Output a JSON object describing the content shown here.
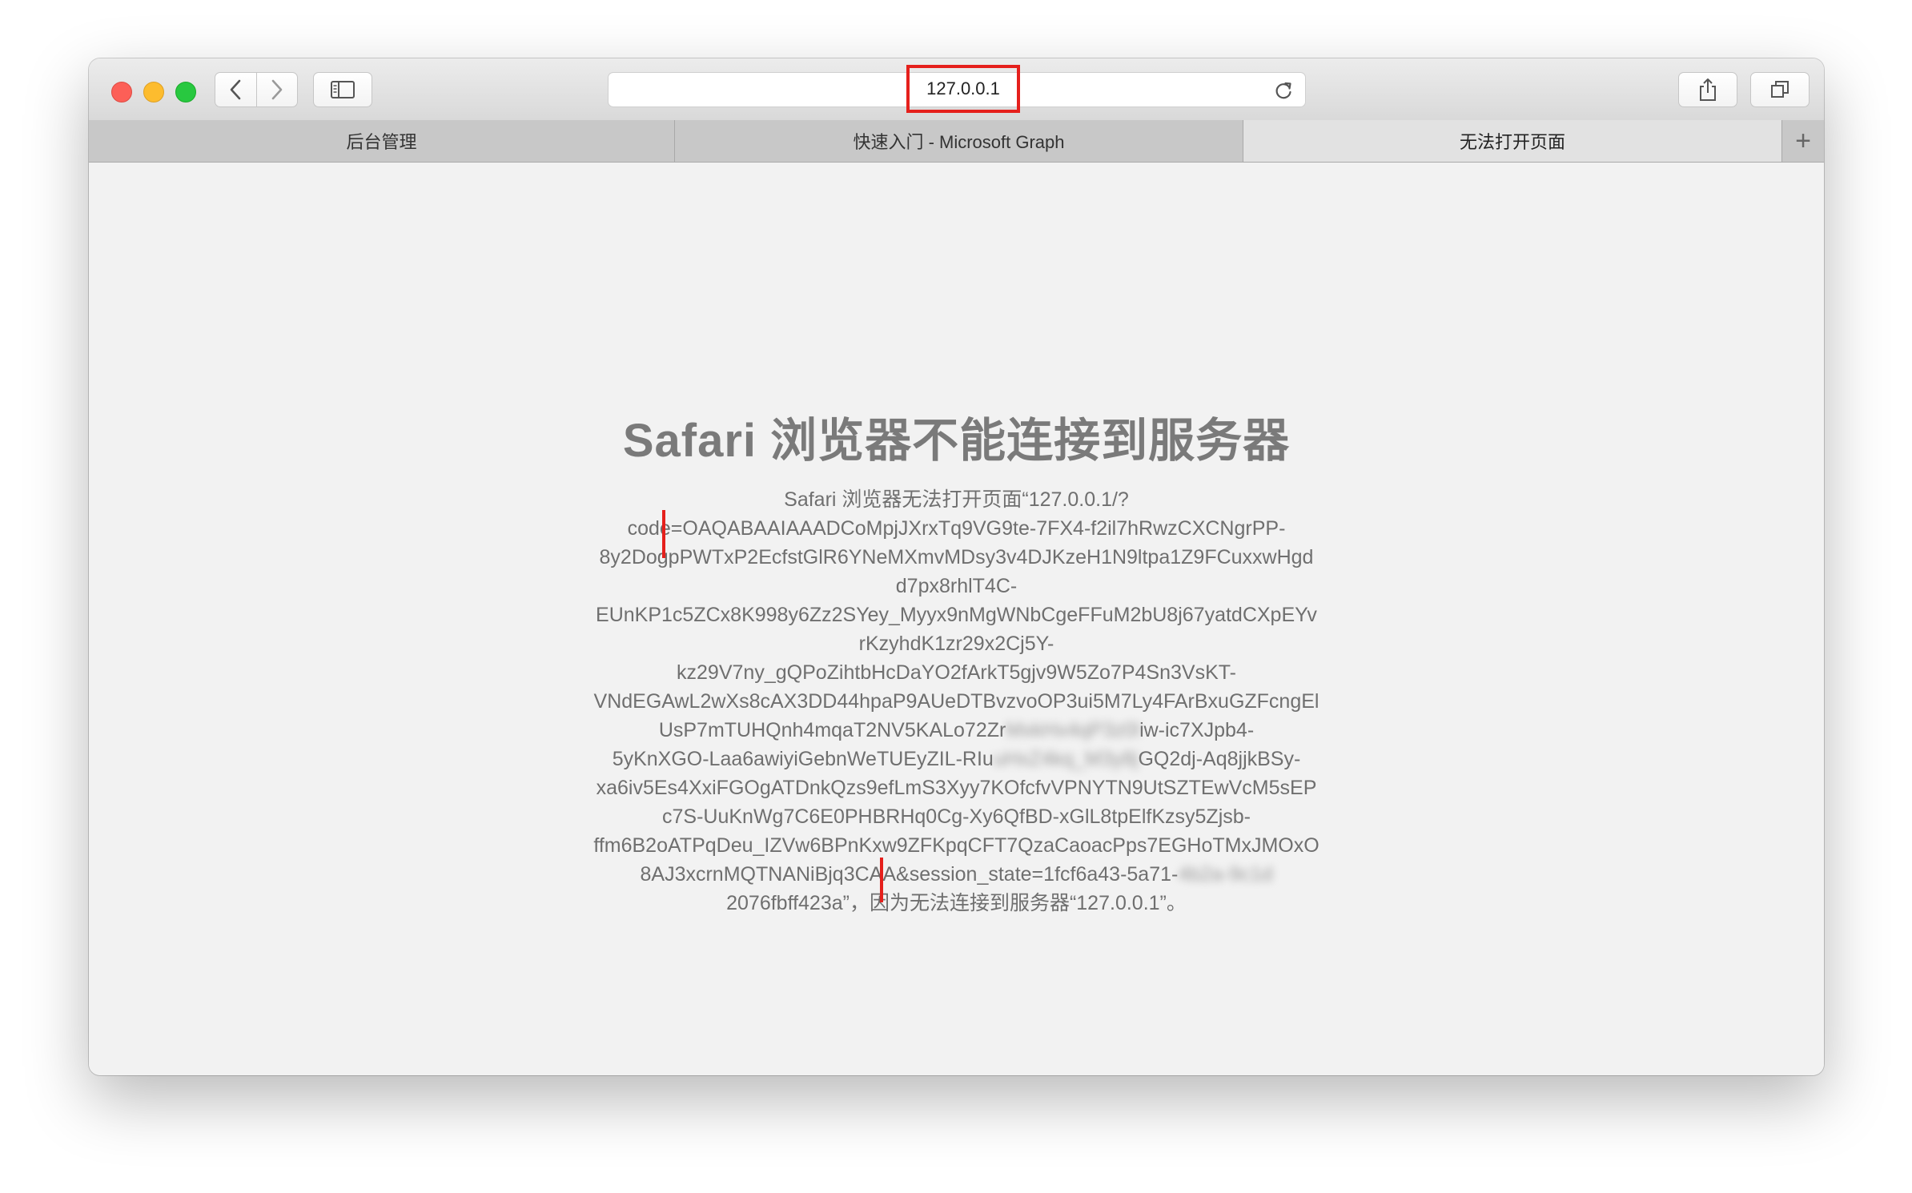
{
  "window": {
    "traffic_lights": {
      "close": "#fc5f57",
      "minimize": "#fdbc2e",
      "maximize": "#28c840"
    }
  },
  "toolbar": {
    "back_icon": "chevron-left",
    "forward_icon": "chevron-right",
    "sidebar_icon": "sidebar",
    "address": "127.0.0.1",
    "reload_icon": "reload",
    "share_icon": "share",
    "tabs_icon": "tab-overview",
    "highlight_color": "#e5201c"
  },
  "tabs": [
    {
      "label": "后台管理",
      "active": false
    },
    {
      "label": "快速入门 - Microsoft Graph",
      "active": false
    },
    {
      "label": "无法打开页面",
      "active": true
    }
  ],
  "new_tab_symbol": "+",
  "error": {
    "title": "Safari 浏览器不能连接到服务器",
    "lines": [
      "Safari 浏览器无法打开页面“127.0.0.1/?",
      "code=OAQABAAIAAADCoMpjJXrxTq9VG9te-7FX4-f2il7hRwzCXCNgrPP-",
      "8y2DogpPWTxP2EcfstGlR6YNeMXmvMDsy3v4DJKzeH1N9ltpa1Z9FCuxxwHgd",
      "d7px8rhlT4C-",
      "EUnKP1c5ZCx8K998y6Zz2SYey_Myyx9nMgWNbCgeFFuM2bU8j67yatdCXpEYv",
      "rKzyhdK1zr29x2Cj5Y-",
      "kz29V7ny_gQPoZihtbHcDaYO2fArkT5gjv9W5Zo7P4Sn3VsKT-",
      "VNdEGAwL2wXs8cAX3DD44hpaP9AUeDTBvzvoOP3ui5M7Ly4FArBxuGZFcngEl"
    ],
    "line9_a": "UsP7mTUHQnh4mqaT2NV5KALo72Zr",
    "line9_b": "iw-ic7XJpb4-",
    "line10_a": "5yKnXGO-Laa6awiyiGebnWeTUEyZIL-RIu",
    "line10_b": "GQ2dj-Aq8jjkBSy-",
    "lines_after": [
      "xa6iv5Es4XxiFGOgATDnkQzs9efLmS3Xyy7KOfcfvVPNYTN9UtSZTEwVcM5sEP",
      "c7S-UuKnWg7C6E0PHBRHq0Cg-Xy6QfBD-xGlL8tpElfKzsy5Zjsb-",
      "ffm6B2oATPqDeu_IZVw6BPnKxw9ZFKpqCFT7QzaCaoacPps7EGHoTMxJMOxO"
    ],
    "line14_a": "8AJ3xcrnMQTNANiBjq3CAA&session_state=1fcf6a43-5a71-",
    "line15": "2076fbff423a”，因为无法连接到服务器“127.0.0.1”。"
  }
}
